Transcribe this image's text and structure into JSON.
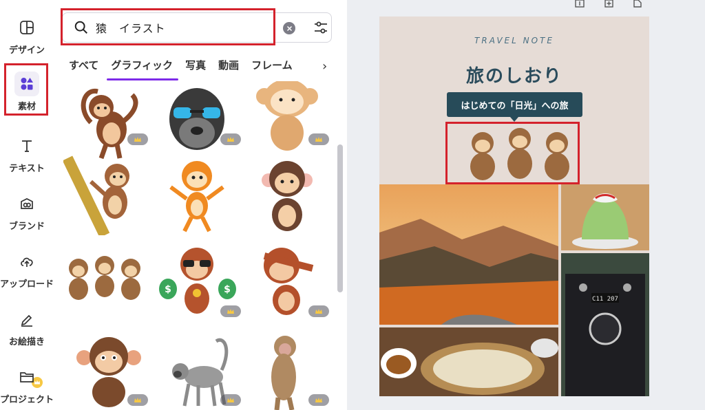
{
  "rail": {
    "items": [
      {
        "label": "デザイン",
        "icon": "layout-icon"
      },
      {
        "label": "素材",
        "icon": "shapes-icon"
      },
      {
        "label": "テキスト",
        "icon": "text-icon"
      },
      {
        "label": "ブランド",
        "icon": "brand-icon"
      },
      {
        "label": "アップロード",
        "icon": "upload-icon"
      },
      {
        "label": "お絵描き",
        "icon": "draw-icon"
      },
      {
        "label": "プロジェクト",
        "icon": "folder-icon"
      }
    ]
  },
  "search": {
    "value": "猿　イラスト"
  },
  "tabs": [
    "すべて",
    "グラフィック",
    "写真",
    "動画",
    "フレーム"
  ],
  "design": {
    "tagline": "TRAVEL NOTE",
    "title": "旅のしおり",
    "subtitle": "はじめての「日光」への旅",
    "train_plate": "C11 207"
  },
  "colors": {
    "accent": "#7d2ae8",
    "highlight": "#d4222c",
    "design_bg": "#e6dcd6",
    "design_banner": "#274b59"
  }
}
